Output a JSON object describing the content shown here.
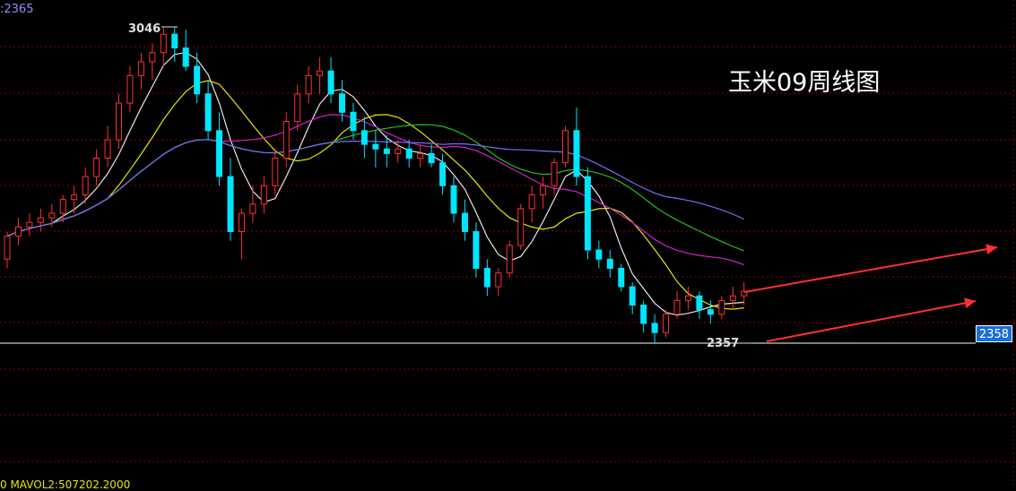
{
  "header": {
    "indicator_text": ":2365"
  },
  "title": "玉米09周线图",
  "footer": {
    "volume_text": "0 MAVOL2:507202.2000"
  },
  "price_tag": "2358",
  "colors": {
    "background": "#000000",
    "grid": "#8b0000",
    "up_candle": "#ff3030",
    "down_candle": "#00e5ff",
    "ma_white": "#e8e8e8",
    "ma_yellow": "#e6e600",
    "ma_magenta": "#d020d0",
    "ma_green": "#20c020",
    "ma_blue": "#7070ff",
    "trend_arrow": "#ff3030",
    "price_tag_bg": "#1a6fd8"
  },
  "chart_data": {
    "type": "candlestick",
    "title": "玉米09周线图",
    "xlabel": "",
    "ylabel": "",
    "ylim": [
      2300,
      3100
    ],
    "annotations": [
      {
        "text": "3046",
        "value": 3046,
        "kind": "high"
      },
      {
        "text": "2357",
        "value": 2357,
        "kind": "low"
      }
    ],
    "last_price": 2358,
    "grid": true,
    "candles": [
      [
        2540,
        2600,
        2520,
        2590
      ],
      [
        2590,
        2630,
        2570,
        2610
      ],
      [
        2610,
        2640,
        2590,
        2620
      ],
      [
        2620,
        2650,
        2600,
        2630
      ],
      [
        2630,
        2660,
        2610,
        2640
      ],
      [
        2640,
        2680,
        2620,
        2670
      ],
      [
        2670,
        2700,
        2640,
        2680
      ],
      [
        2680,
        2740,
        2660,
        2720
      ],
      [
        2720,
        2780,
        2700,
        2760
      ],
      [
        2760,
        2830,
        2740,
        2800
      ],
      [
        2800,
        2900,
        2780,
        2880
      ],
      [
        2880,
        2960,
        2860,
        2940
      ],
      [
        2940,
        2990,
        2910,
        2970
      ],
      [
        2970,
        3010,
        2930,
        2990
      ],
      [
        2990,
        3046,
        2960,
        3030
      ],
      [
        3030,
        3046,
        2970,
        3000
      ],
      [
        3000,
        3040,
        2950,
        2960
      ],
      [
        2960,
        2990,
        2880,
        2900
      ],
      [
        2900,
        2930,
        2800,
        2820
      ],
      [
        2820,
        2860,
        2700,
        2720
      ],
      [
        2720,
        2760,
        2580,
        2600
      ],
      [
        2600,
        2650,
        2540,
        2640
      ],
      [
        2640,
        2700,
        2620,
        2660
      ],
      [
        2660,
        2720,
        2640,
        2700
      ],
      [
        2700,
        2780,
        2680,
        2760
      ],
      [
        2760,
        2860,
        2740,
        2840
      ],
      [
        2840,
        2920,
        2820,
        2900
      ],
      [
        2900,
        2960,
        2880,
        2940
      ],
      [
        2940,
        2980,
        2900,
        2950
      ],
      [
        2950,
        2980,
        2880,
        2900
      ],
      [
        2900,
        2930,
        2840,
        2860
      ],
      [
        2860,
        2880,
        2800,
        2820
      ],
      [
        2820,
        2850,
        2760,
        2790
      ],
      [
        2790,
        2820,
        2740,
        2780
      ],
      [
        2780,
        2810,
        2740,
        2770
      ],
      [
        2770,
        2800,
        2750,
        2780
      ],
      [
        2780,
        2800,
        2740,
        2760
      ],
      [
        2760,
        2790,
        2740,
        2770
      ],
      [
        2770,
        2790,
        2740,
        2750
      ],
      [
        2750,
        2770,
        2680,
        2700
      ],
      [
        2700,
        2720,
        2620,
        2640
      ],
      [
        2640,
        2670,
        2580,
        2600
      ],
      [
        2600,
        2620,
        2500,
        2520
      ],
      [
        2520,
        2540,
        2460,
        2480
      ],
      [
        2480,
        2520,
        2460,
        2510
      ],
      [
        2510,
        2580,
        2500,
        2570
      ],
      [
        2570,
        2660,
        2560,
        2650
      ],
      [
        2650,
        2700,
        2620,
        2680
      ],
      [
        2680,
        2720,
        2650,
        2700
      ],
      [
        2700,
        2760,
        2680,
        2750
      ],
      [
        2750,
        2830,
        2740,
        2820
      ],
      [
        2820,
        2870,
        2700,
        2720
      ],
      [
        2720,
        2740,
        2540,
        2560
      ],
      [
        2560,
        2580,
        2520,
        2540
      ],
      [
        2540,
        2560,
        2500,
        2520
      ],
      [
        2520,
        2530,
        2470,
        2480
      ],
      [
        2480,
        2490,
        2420,
        2440
      ],
      [
        2440,
        2450,
        2380,
        2400
      ],
      [
        2400,
        2420,
        2357,
        2380
      ],
      [
        2380,
        2430,
        2370,
        2420
      ],
      [
        2420,
        2470,
        2410,
        2450
      ],
      [
        2450,
        2480,
        2430,
        2460
      ],
      [
        2460,
        2470,
        2410,
        2430
      ],
      [
        2430,
        2450,
        2400,
        2420
      ],
      [
        2420,
        2460,
        2410,
        2450
      ],
      [
        2450,
        2480,
        2430,
        2460
      ],
      [
        2460,
        2490,
        2440,
        2470
      ]
    ]
  }
}
